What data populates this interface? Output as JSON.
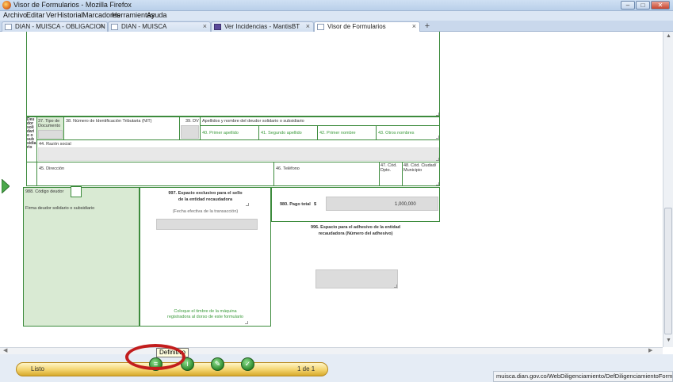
{
  "window": {
    "title": "Visor de Formularios - Mozilla Firefox",
    "controls": {
      "minimize": "–",
      "maximize": "□",
      "close": "✕"
    }
  },
  "menubar": {
    "items": [
      "Archivo",
      "Editar",
      "Ver",
      "Historial",
      "Marcadores",
      "Herramientas",
      "Ayuda"
    ]
  },
  "tabs": [
    {
      "label": "DIAN - MUISCA - OBLIGACION FINA..."
    },
    {
      "label": "DIAN - MUISCA"
    },
    {
      "label": "Ver Incidencias - MantisBT"
    },
    {
      "label": "Visor de Formularios"
    }
  ],
  "new_tab_label": "+",
  "form": {
    "deudor_side_label": "Deu dor soli dari o o sub sidia rio",
    "f37": "37. Tipo de Documento",
    "f38": "38. Número de Identificación Tributaria (NIT)",
    "f39": "39. DV",
    "name_header": "Apellidos y nombre del deudor solidario o subsidiario",
    "f40": "40. Primer apellido",
    "f41": "41. Segundo apellido",
    "f42": "42. Primer nombre",
    "f43": "43. Otros nombres",
    "f44": "44. Razón social",
    "f45": "45. Dirección",
    "f46": "46. Teléfono",
    "f47": "47. Cód. Dpto.",
    "f48": "48. Cód. Ciudad/ Municipio",
    "f988": "988. Código deudor",
    "firma": "Firma deudor solidario o subsidiario",
    "f997_line1": "997. Espacio exclusivo para el sello",
    "f997_line2": "de la entidad recaudadora",
    "f997_sub": "(Fecha efectiva de la transacción)",
    "timbre_line1": "Coloque el timbre de la máquina",
    "timbre_line2": "registradora al dorso de este formulario",
    "f980": "980. Pago total",
    "currency": "$",
    "pago_total": "1,000,000",
    "f996_line1": "996. Espacio para el adhesivo de la entidad",
    "f996_line2": "recaudadora (Número del adhesivo)"
  },
  "bottom": {
    "status": "Listo",
    "tooltip": "Definitivo",
    "page_indicator": "1 de 1",
    "url_status": "muisca.dian.gov.co/WebDiligenciamiento/DefDiligenciamientoFormularios.faces#"
  },
  "icons": {
    "firefox": "firefox-logo-icon",
    "side_arrow": "chevron-right-icon",
    "buttons": [
      "definitivo-icon",
      "info-icon",
      "edit-icon",
      "validate-icon"
    ]
  },
  "colors": {
    "form_green": "#3d8b3d",
    "label_green": "#3a9a3a",
    "fill_green": "#d9ead3",
    "highlight_red": "#c21d1d"
  }
}
